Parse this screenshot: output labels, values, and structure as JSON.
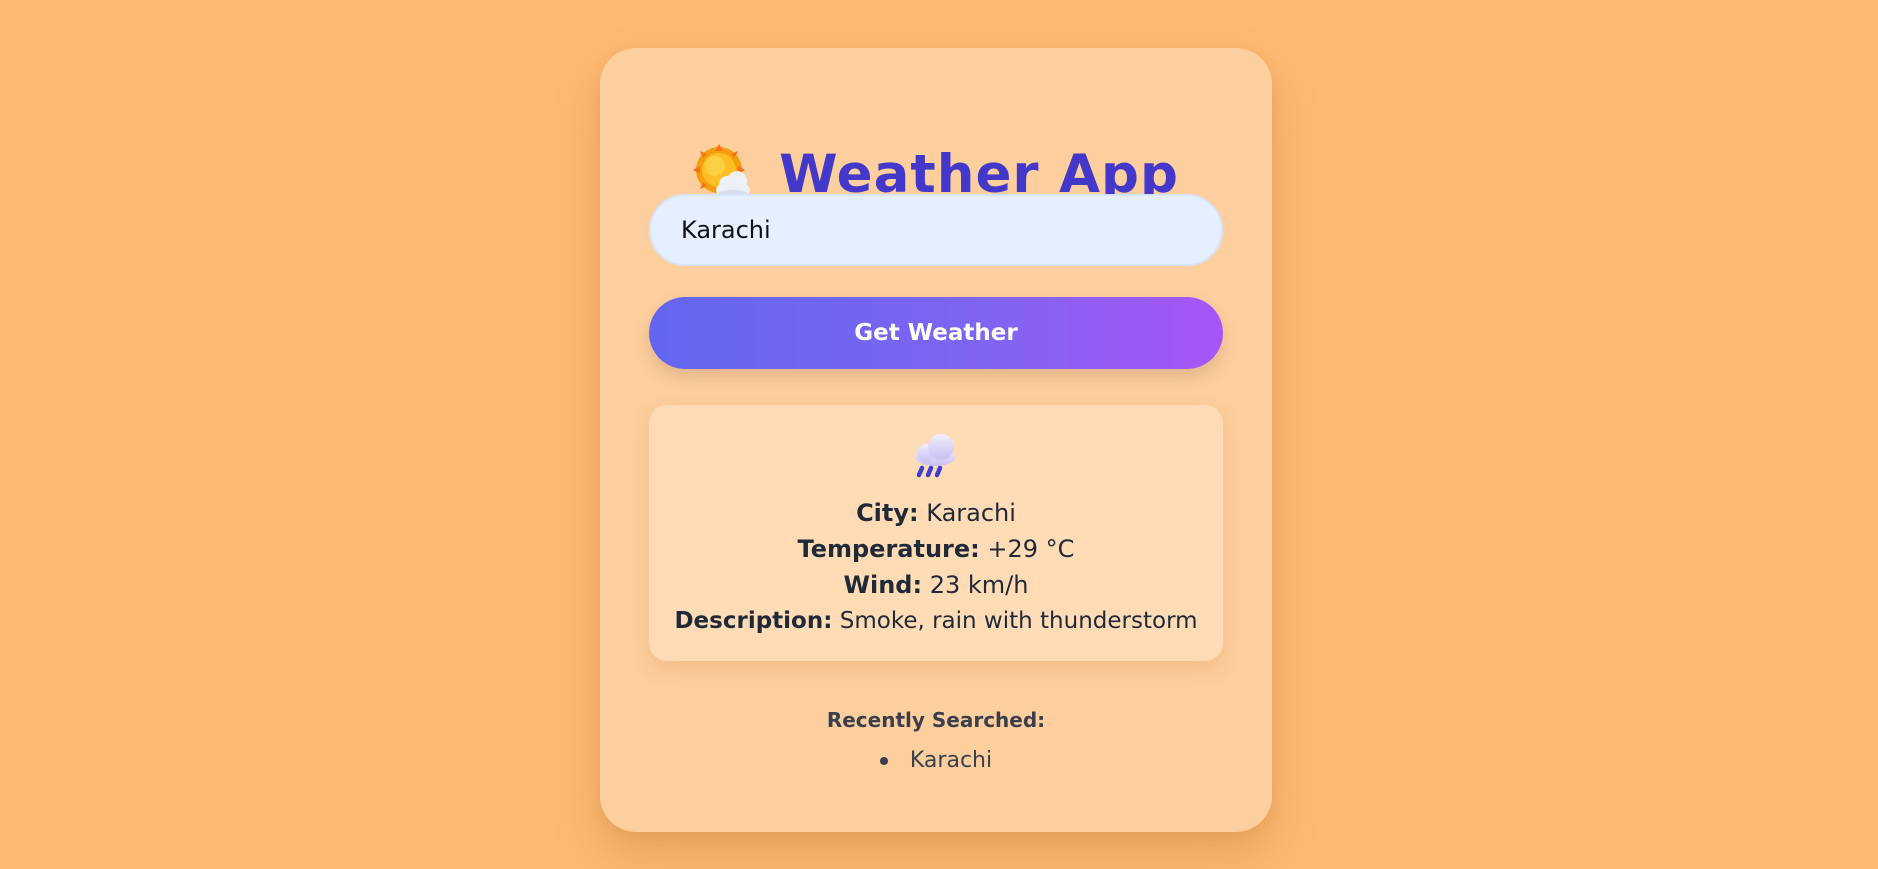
{
  "app": {
    "title": "Weather App",
    "title_icon": "sun-behind-cloud-icon"
  },
  "search": {
    "value": "Karachi"
  },
  "button": {
    "label": "Get Weather"
  },
  "result": {
    "icon": "rain-cloud-icon",
    "city_label": "City:",
    "city_value": "Karachi",
    "temperature_label": "Temperature:",
    "temperature_value": "+29 °C",
    "wind_label": "Wind:",
    "wind_value": "23 km/h",
    "description_label": "Description:",
    "description_value": "Smoke, rain with thunderstorm"
  },
  "recent": {
    "heading": "Recently Searched:",
    "items": [
      "Karachi"
    ]
  },
  "colors": {
    "background": "#fdb973",
    "card": "#fdcf9e",
    "title": "#4338ca",
    "button_start": "#6366f1",
    "button_end": "#a855f7",
    "input_bg": "#e6efff",
    "result_bg": "#ffdcb6"
  }
}
